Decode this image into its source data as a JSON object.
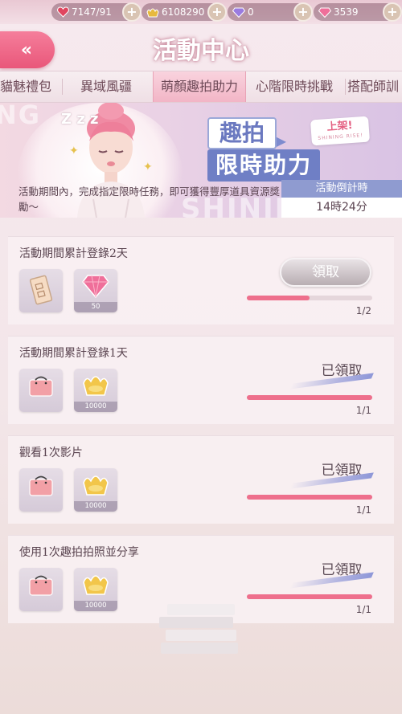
{
  "resources": [
    {
      "icon": "heart-icon",
      "value": "7147/91",
      "color": "#e0455f"
    },
    {
      "icon": "gold-ingot-icon",
      "value": "6108290",
      "color": "#e7b93e"
    },
    {
      "icon": "purple-diamond-icon",
      "value": "0",
      "color": "#9a7be0"
    },
    {
      "icon": "pink-diamond-icon",
      "value": "3539",
      "color": "#ef6f9a"
    }
  ],
  "header": {
    "title": "活動中心",
    "back_glyph": "«"
  },
  "tabs": [
    {
      "label": "貓魅禮包",
      "active": false
    },
    {
      "label": "異域風疆",
      "active": false
    },
    {
      "label": "萌顏趣拍助力",
      "active": true
    },
    {
      "label": "心階限時挑戰",
      "active": false
    },
    {
      "label": "搭配師訓",
      "active": false
    }
  ],
  "banner": {
    "title_line1": "趣拍",
    "title_line2": "限時助力",
    "badge": "上架!",
    "badge_sub": "SHINING RISE!",
    "description": "活動期間內，完成指定限時任務，即可獲得豐厚道具資源獎勵～",
    "countdown_label": "活動倒計時",
    "countdown_value": "14時24分",
    "zzz": "Z z z"
  },
  "tasks": [
    {
      "title": "活動期間累計登錄2天",
      "rewards": [
        {
          "icon": "ticket-card-icon",
          "qty": ""
        },
        {
          "icon": "pink-diamond-icon",
          "qty": "50"
        }
      ],
      "action": "領取",
      "claimed": false,
      "progress": 0.5,
      "progress_text": "1/2"
    },
    {
      "title": "活動期間累計登錄1天",
      "rewards": [
        {
          "icon": "pink-bag-icon",
          "qty": ""
        },
        {
          "icon": "gold-ingot-icon",
          "qty": "10000"
        }
      ],
      "action": "已領取",
      "claimed": true,
      "progress": 1,
      "progress_text": "1/1"
    },
    {
      "title": "觀看1次影片",
      "rewards": [
        {
          "icon": "pink-bag-icon",
          "qty": ""
        },
        {
          "icon": "gold-ingot-icon",
          "qty": "10000"
        }
      ],
      "action": "已領取",
      "claimed": true,
      "progress": 1,
      "progress_text": "1/1"
    },
    {
      "title": "使用1次趣拍拍照並分享",
      "rewards": [
        {
          "icon": "pink-bag-icon",
          "qty": ""
        },
        {
          "icon": "gold-ingot-icon",
          "qty": "10000"
        }
      ],
      "action": "已領取",
      "claimed": true,
      "progress": 1,
      "progress_text": "1/1"
    }
  ]
}
